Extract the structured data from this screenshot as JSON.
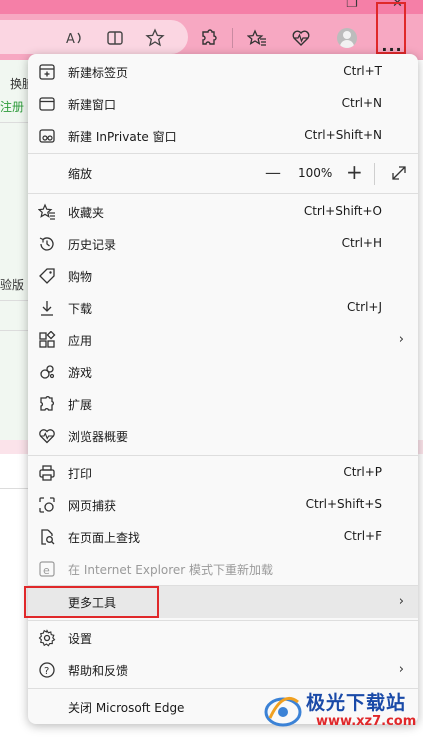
{
  "window": {
    "close_glyph": "✕",
    "restore_glyph": "❐"
  },
  "toolbar": {
    "read_aloud_icon": "read-aloud-icon",
    "split_screen_icon": "split-screen-icon",
    "favorite_star_icon": "star-icon",
    "extensions_icon": "extensions-icon",
    "favorites_icon": "favorites-icon",
    "browser_essentials_icon": "heart-pulse-icon",
    "profile_icon": "avatar",
    "more_label": "···"
  },
  "background_page": {
    "snippet_1": "换腻",
    "snippet_2": "注册",
    "snippet_3": "验版"
  },
  "menu": {
    "items": [
      {
        "label": "新建标签页",
        "shortcut": "Ctrl+T"
      },
      {
        "label": "新建窗口",
        "shortcut": "Ctrl+N"
      },
      {
        "label": "新建 InPrivate 窗口",
        "shortcut": "Ctrl+Shift+N"
      },
      {
        "label": "缩放",
        "zoom_value": "100%",
        "minus": "—",
        "plus": "+"
      },
      {
        "label": "收藏夹",
        "shortcut": "Ctrl+Shift+O"
      },
      {
        "label": "历史记录",
        "shortcut": "Ctrl+H"
      },
      {
        "label": "购物",
        "shortcut": ""
      },
      {
        "label": "下载",
        "shortcut": "Ctrl+J"
      },
      {
        "label": "应用",
        "submenu": "›"
      },
      {
        "label": "游戏",
        "shortcut": ""
      },
      {
        "label": "扩展",
        "shortcut": ""
      },
      {
        "label": "浏览器概要",
        "shortcut": ""
      },
      {
        "label": "打印",
        "shortcut": "Ctrl+P"
      },
      {
        "label": "网页捕获",
        "shortcut": "Ctrl+Shift+S"
      },
      {
        "label": "在页面上查找",
        "shortcut": "Ctrl+F"
      },
      {
        "label": "在 Internet Explorer 模式下重新加载",
        "disabled": true
      },
      {
        "label": "更多工具",
        "submenu": "›"
      },
      {
        "label": "设置",
        "shortcut": ""
      },
      {
        "label": "帮助和反馈",
        "submenu": "›"
      },
      {
        "label": "关闭 Microsoft Edge",
        "shortcut": ""
      }
    ]
  },
  "watermark": {
    "name": "极光下载站",
    "url": "www.xz7.com"
  },
  "colors": {
    "titlebar": "#f57fa7",
    "toolbar": "#f7a8c2",
    "highlight_box": "#e0282a",
    "watermark_blue": "#1a4aa8"
  }
}
